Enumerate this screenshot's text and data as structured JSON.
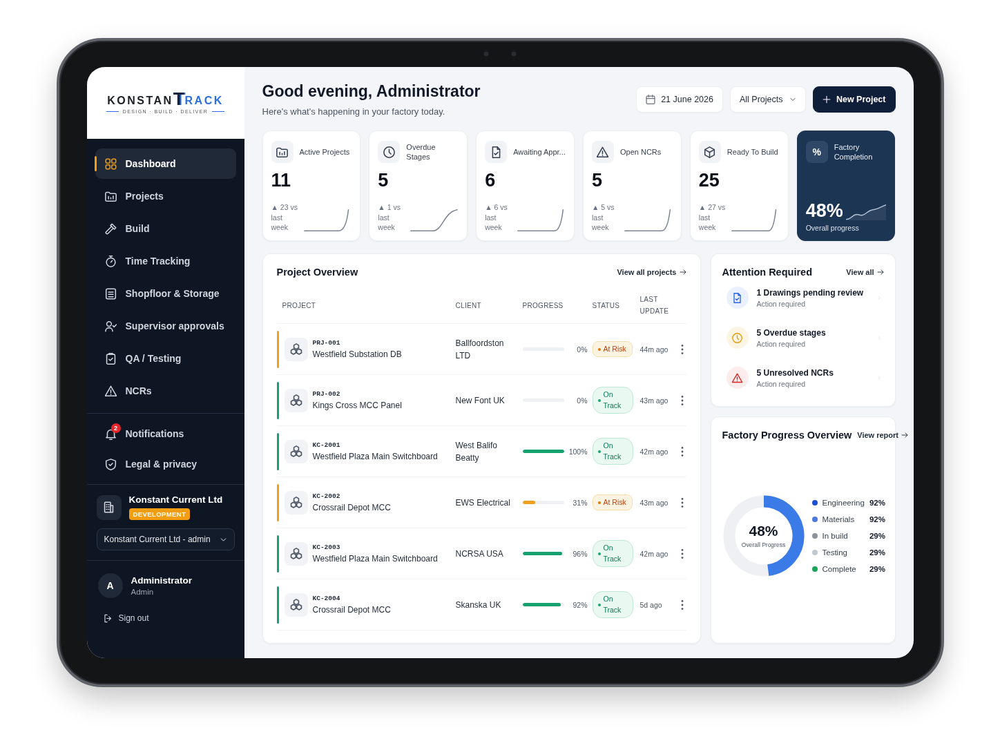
{
  "sidebar": {
    "logo": {
      "wordmark": [
        "KONSTAN",
        "T",
        "RACK"
      ],
      "tagline": "DESIGN · BUILD · DELIVER"
    },
    "nav": [
      {
        "label": "Dashboard",
        "selected": true
      },
      {
        "label": "Projects",
        "selected": false
      },
      {
        "label": "Build",
        "selected": false
      },
      {
        "label": "Time Tracking",
        "selected": false
      },
      {
        "label": "Shopfloor & Storage",
        "selected": false
      },
      {
        "label": "Supervisor approvals",
        "selected": false
      },
      {
        "label": "QA / Testing",
        "selected": false
      },
      {
        "label": "NCRs",
        "selected": false
      }
    ],
    "nav_secondary": [
      {
        "label": "Notifications",
        "selected": false,
        "badge": "2"
      },
      {
        "label": "Legal & privacy",
        "selected": false
      }
    ],
    "organization": {
      "name": "Konstant Current Ltd",
      "environment": "DEVELOPMENT",
      "account_select": "Konstant Current Ltd - admin"
    },
    "user": {
      "avatar_initial": "A",
      "name": "Administrator",
      "role": "Admin"
    },
    "sign_out": "Sign out"
  },
  "header": {
    "title": "Good evening, Administrator",
    "subtitle": "Here's what's happening in your factory today.",
    "date": "21 June 2026",
    "project_filter": "All Projects",
    "new_project_button": "New Project"
  },
  "stats": [
    {
      "kind": "standard",
      "label": "Active Projects",
      "value": "11",
      "delta": "▲ 23 vs last week"
    },
    {
      "kind": "standard",
      "label": "Overdue Stages",
      "value": "5",
      "delta": "▲ 1 vs last week"
    },
    {
      "kind": "standard",
      "label": "Awaiting Appr...",
      "value": "6",
      "delta": "▲ 6 vs last week"
    },
    {
      "kind": "standard",
      "label": "Open NCRs",
      "value": "5",
      "delta": "▲ 5 vs last week"
    },
    {
      "kind": "standard",
      "label": "Ready To Build",
      "value": "25",
      "delta": "▲ 27 vs last week"
    },
    {
      "kind": "highlight",
      "icon_text": "%",
      "label": "Factory Completion",
      "value": "48%",
      "caption": "Overall progress"
    }
  ],
  "project_overview": {
    "title": "Project Overview",
    "link": "View all projects",
    "columns": [
      "PROJECT",
      "CLIENT",
      "PROGRESS",
      "STATUS",
      "LAST UPDATE"
    ],
    "rows": [
      {
        "code": "PRJ-001",
        "name": "Westfield Substation DB",
        "client": "Ballfoordston LTD",
        "level": 0,
        "progress": "0%",
        "status": {
          "label": "At Risk",
          "kind": "at_risk"
        },
        "last_update": "44m ago"
      },
      {
        "code": "PRJ-002",
        "name": "Kings Cross MCC Panel",
        "client": "New Font UK",
        "level": 0,
        "progress": "0%",
        "status": {
          "label": "On Track",
          "kind": "on_track"
        },
        "last_update": "43m ago"
      },
      {
        "code": "KC-2001",
        "name": "Westfield Plaza Main Switchboard",
        "client": "West Balifo Beatty",
        "level": 1,
        "progress": "100%",
        "status": {
          "label": "On Track",
          "kind": "on_track"
        },
        "last_update": "42m ago"
      },
      {
        "code": "KC-2002",
        "name": "Crossrail Depot MCC",
        "client": "EWS Electrical",
        "level": 0.31,
        "progress": "31%",
        "status": {
          "label": "At Risk",
          "kind": "at_risk"
        },
        "last_update": "43m ago"
      },
      {
        "code": "KC-2003",
        "name": "Westfield Plaza Main Switchboard",
        "client": "NCRSA USA",
        "level": 0.96,
        "progress": "96%",
        "status": {
          "label": "On Track",
          "kind": "on_track"
        },
        "last_update": "42m ago"
      },
      {
        "code": "KC-2004",
        "name": "Crossrail Depot MCC",
        "client": "Skanska UK",
        "level": 0.92,
        "progress": "92%",
        "status": {
          "label": "On Track",
          "kind": "on_track"
        },
        "last_update": "5d ago"
      }
    ]
  },
  "attention": {
    "title": "Attention Required",
    "link": "View all",
    "items": [
      {
        "kind": "document",
        "title": "1 Drawings pending review",
        "subtitle": "Action required"
      },
      {
        "kind": "clock",
        "title": "5 Overdue stages",
        "subtitle": "Action required"
      },
      {
        "kind": "warning",
        "title": "5 Unresolved NCRs",
        "subtitle": "Action required"
      }
    ]
  },
  "factory_progress": {
    "title": "Factory Progress Overview",
    "link": "View report",
    "level": 0.48,
    "value": "48%",
    "caption": "Overall Progress",
    "legend": [
      {
        "label": "Engineering",
        "value": "92%",
        "color": "#1f4fd1"
      },
      {
        "label": "Materials",
        "value": "92%",
        "color": "#4c78e0"
      },
      {
        "label": "In build",
        "value": "29%",
        "color": "#8d929b"
      },
      {
        "label": "Testing",
        "value": "29%",
        "color": "#c3c7ce"
      },
      {
        "label": "Complete",
        "value": "29%",
        "color": "#19a35b"
      }
    ]
  }
}
